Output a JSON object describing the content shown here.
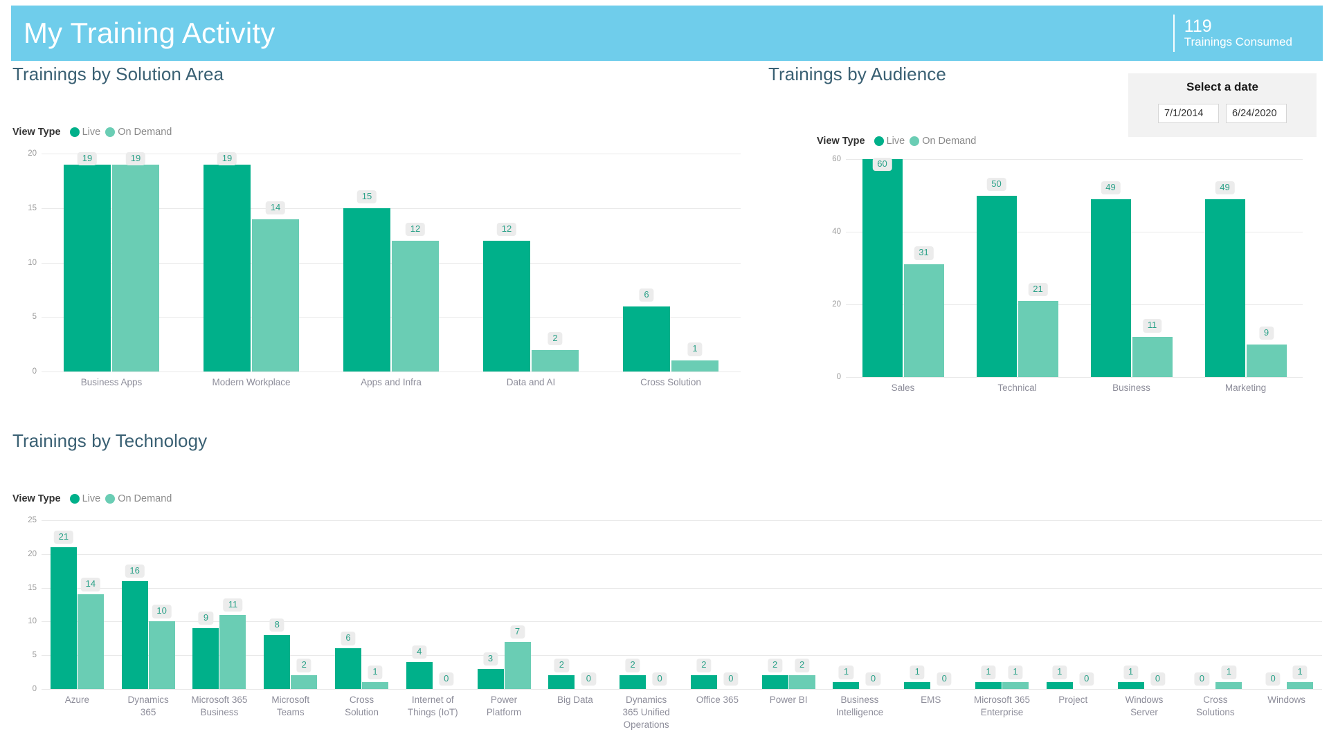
{
  "header": {
    "title": "My Training Activity",
    "kpi_value": "119",
    "kpi_label": "Trainings Consumed",
    "background_color": "#6fcdeb"
  },
  "legend": {
    "caption": "View Type",
    "live_label": "Live",
    "ondemand_label": "On Demand",
    "live_color": "#00b08a",
    "ondemand_color": "#6acdb4"
  },
  "date_slicer": {
    "title": "Select a date",
    "start_date": "7/1/2014",
    "end_date": "6/24/2020"
  },
  "panels": {
    "solution_area_title": "Trainings by Solution Area",
    "audience_title": "Trainings by Audience",
    "technology_title": "Trainings by Technology"
  },
  "chart_data": [
    {
      "id": "solution_area",
      "type": "bar",
      "title": "Trainings by Solution Area",
      "xlabel": "",
      "ylabel": "",
      "ylim": [
        0,
        20
      ],
      "yticks": [
        0,
        5,
        10,
        15,
        20
      ],
      "grid": true,
      "legend_position": "top-left",
      "categories": [
        "Business Apps",
        "Modern Workplace",
        "Apps and Infra",
        "Data and AI",
        "Cross Solution"
      ],
      "series": [
        {
          "name": "Live",
          "color": "#00b08a",
          "values": [
            19,
            19,
            15,
            12,
            6
          ]
        },
        {
          "name": "On Demand",
          "color": "#6acdb4",
          "values": [
            19,
            14,
            12,
            2,
            1
          ]
        }
      ]
    },
    {
      "id": "audience",
      "type": "bar",
      "title": "Trainings by Audience",
      "xlabel": "",
      "ylabel": "",
      "ylim": [
        0,
        60
      ],
      "yticks": [
        0,
        20,
        40,
        60
      ],
      "grid": true,
      "legend_position": "top-left",
      "categories": [
        "Sales",
        "Technical",
        "Business",
        "Marketing"
      ],
      "series": [
        {
          "name": "Live",
          "color": "#00b08a",
          "values": [
            60,
            50,
            49,
            49
          ]
        },
        {
          "name": "On Demand",
          "color": "#6acdb4",
          "values": [
            31,
            21,
            11,
            9
          ]
        }
      ]
    },
    {
      "id": "technology",
      "type": "bar",
      "title": "Trainings by Technology",
      "xlabel": "",
      "ylabel": "",
      "ylim": [
        0,
        25
      ],
      "yticks": [
        0,
        5,
        10,
        15,
        20,
        25
      ],
      "grid": true,
      "legend_position": "top-left",
      "categories": [
        "Azure",
        "Dynamics\n365",
        "Microsoft 365\nBusiness",
        "Microsoft\nTeams",
        "Cross\nSolution",
        "Internet of\nThings (IoT)",
        "Power\nPlatform",
        "Big Data",
        "Dynamics\n365 Unified\nOperations",
        "Office 365",
        "Power BI",
        "Business\nIntelligence",
        "EMS",
        "Microsoft 365\nEnterprise",
        "Project",
        "Windows\nServer",
        "Cross\nSolutions",
        "Windows"
      ],
      "series": [
        {
          "name": "Live",
          "color": "#00b08a",
          "values": [
            21,
            16,
            9,
            8,
            6,
            4,
            3,
            2,
            2,
            2,
            2,
            1,
            1,
            1,
            1,
            1,
            0,
            0
          ]
        },
        {
          "name": "On Demand",
          "color": "#6acdb4",
          "values": [
            14,
            10,
            11,
            2,
            1,
            0,
            7,
            0,
            0,
            0,
            2,
            0,
            0,
            1,
            0,
            0,
            1,
            1
          ]
        }
      ]
    }
  ]
}
